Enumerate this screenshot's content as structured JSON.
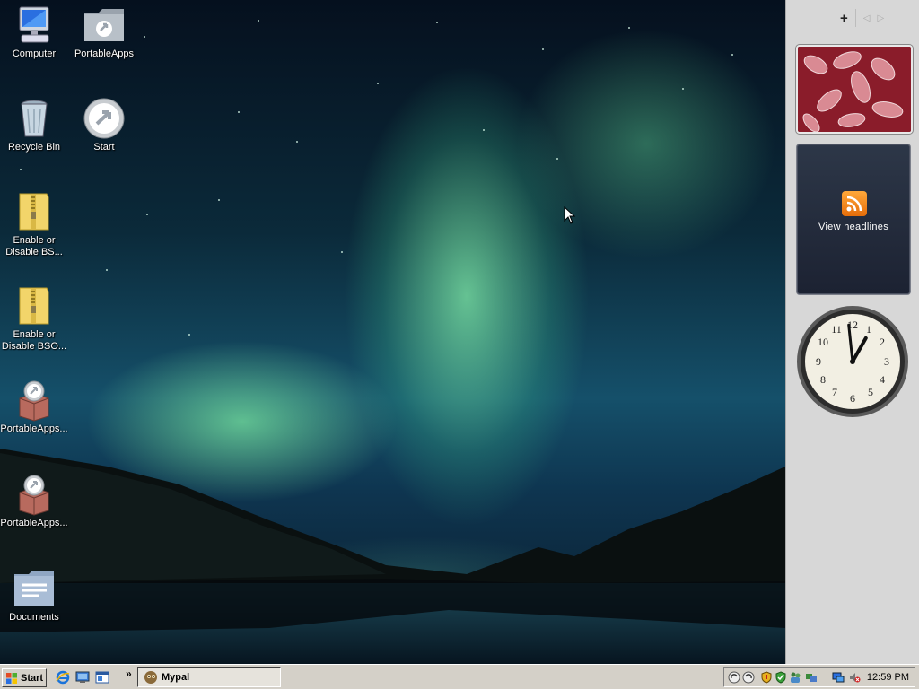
{
  "desktop": {
    "icons": [
      {
        "label": "Computer",
        "icon": "computer-icon"
      },
      {
        "label": "PortableApps",
        "icon": "folder-icon"
      },
      {
        "label": "Recycle Bin",
        "icon": "recycle-bin-icon"
      },
      {
        "label": "Start",
        "icon": "portableapps-start-icon"
      },
      {
        "label": "Enable or Disable BS...",
        "icon": "zip-folder-icon"
      },
      {
        "label": "Enable or Disable BSO...",
        "icon": "zip-folder-icon"
      },
      {
        "label": "PortableApps...",
        "icon": "package-icon"
      },
      {
        "label": "PortableApps...",
        "icon": "package-icon"
      },
      {
        "label": "Documents",
        "icon": "documents-folder-icon"
      }
    ]
  },
  "sidebar": {
    "controls": {
      "add": "+",
      "prev": "◁",
      "next": "▷"
    },
    "feed": {
      "label": "View headlines",
      "icon": "rss-icon"
    },
    "clock": {
      "hour": 12,
      "minute": 59
    }
  },
  "taskbar": {
    "start_label": "Start",
    "quick_launch": [
      "internet-explorer-icon",
      "show-desktop-icon",
      "window-icon"
    ],
    "chevron": "»",
    "tasks": [
      {
        "label": "Mypal",
        "icon": "mypal-icon"
      }
    ],
    "tray_icons": [
      "sync-icon",
      "update-icon",
      "shield-icon",
      "security-center-icon",
      "users-icon",
      "network-icon",
      "display-icon",
      "volume-muted-icon"
    ],
    "time": "12:59 PM"
  },
  "colors": {
    "taskbar": "#d4d0c8",
    "sidebar": "#d7d7d7",
    "aurora": "#7fe6a8"
  }
}
